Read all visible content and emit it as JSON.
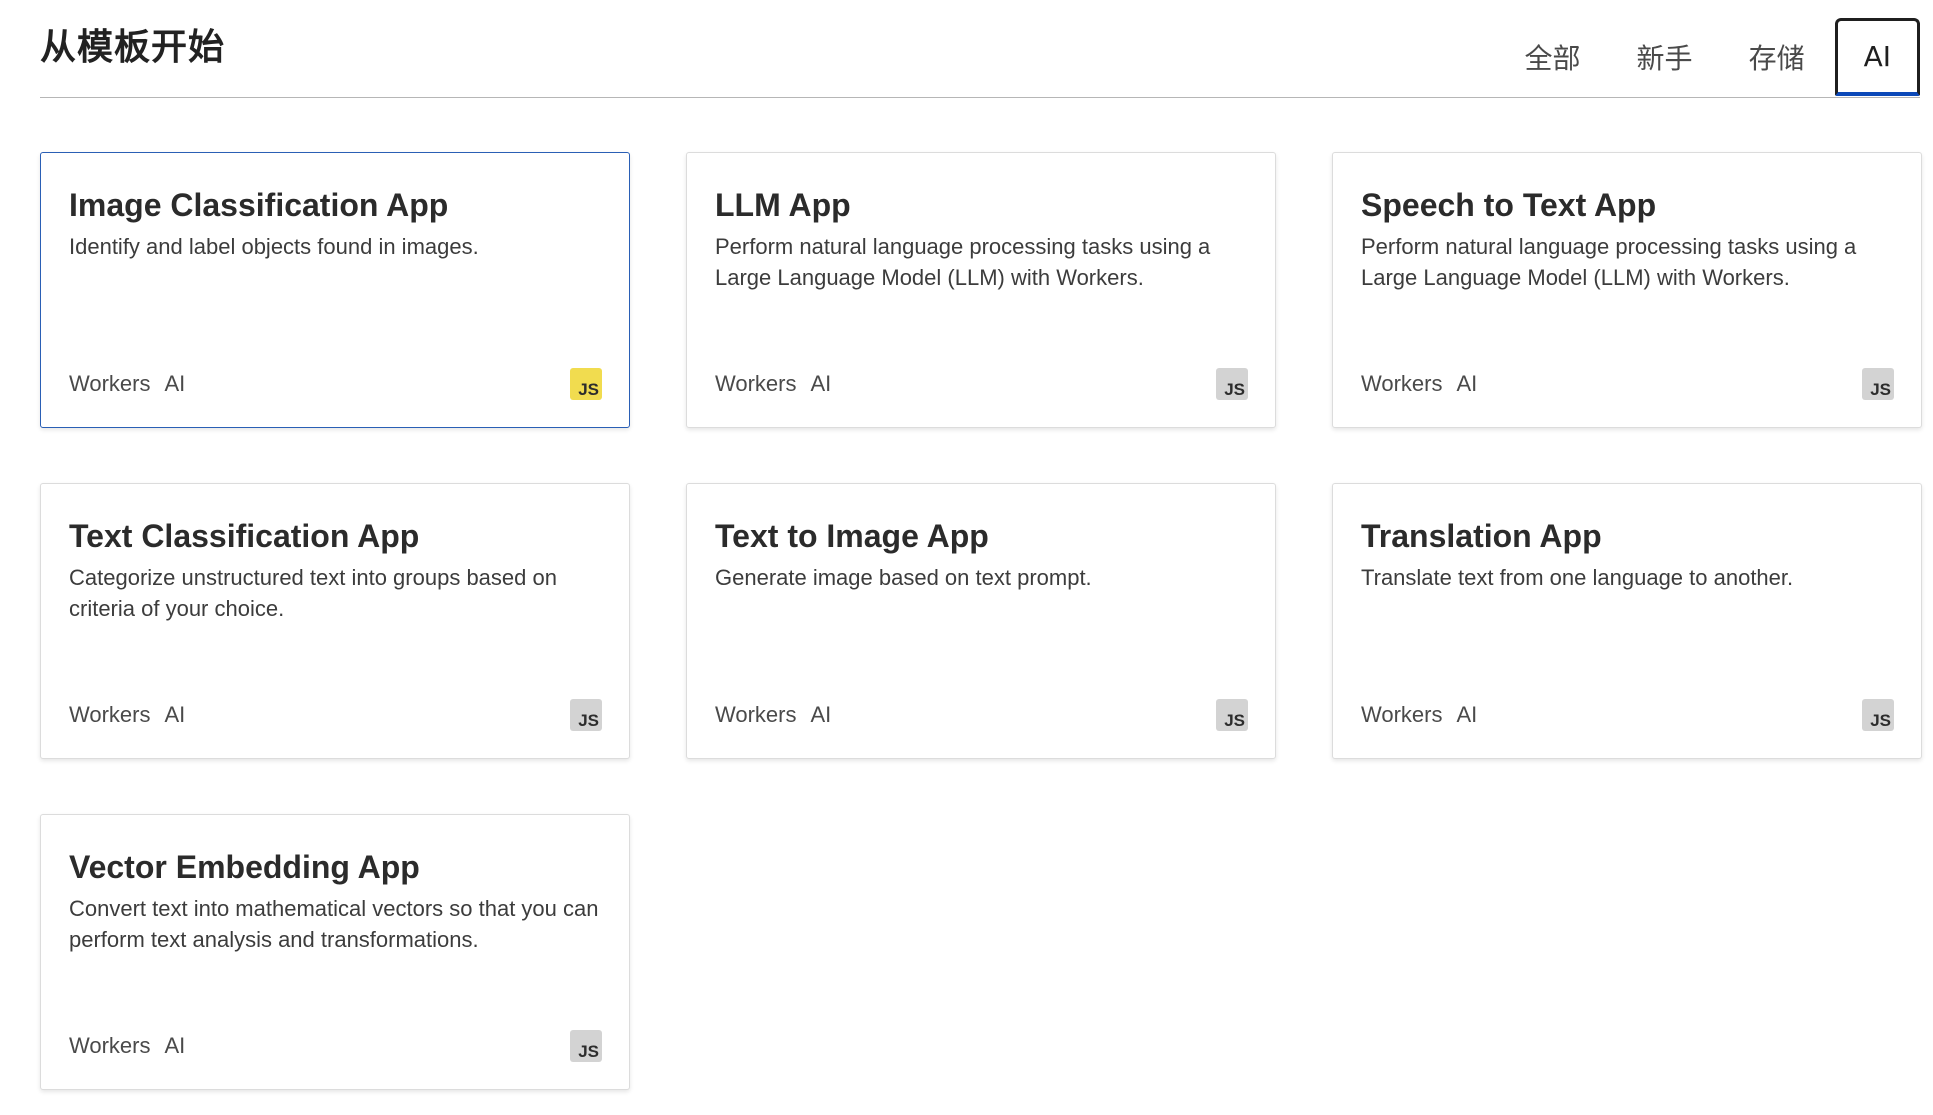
{
  "header": {
    "title": "从模板开始",
    "tabs": [
      {
        "label": "全部",
        "active": false
      },
      {
        "label": "新手",
        "active": false
      },
      {
        "label": "存储",
        "active": false
      },
      {
        "label": "AI",
        "active": true
      }
    ]
  },
  "cards": [
    {
      "title": "Image Classification App",
      "description": "Identify and label objects found in images.",
      "tags": [
        "Workers",
        "AI"
      ],
      "badge": "JS",
      "selected": true
    },
    {
      "title": "LLM App",
      "description": "Perform natural language processing tasks using a Large Language Model (LLM) with Workers.",
      "tags": [
        "Workers",
        "AI"
      ],
      "badge": "JS",
      "selected": false
    },
    {
      "title": "Speech to Text App",
      "description": "Perform natural language processing tasks using a Large Language Model (LLM) with Workers.",
      "tags": [
        "Workers",
        "AI"
      ],
      "badge": "JS",
      "selected": false
    },
    {
      "title": "Text Classification App",
      "description": "Categorize unstructured text into groups based on criteria of your choice.",
      "tags": [
        "Workers",
        "AI"
      ],
      "badge": "JS",
      "selected": false
    },
    {
      "title": "Text to Image App",
      "description": "Generate image based on text prompt.",
      "tags": [
        "Workers",
        "AI"
      ],
      "badge": "JS",
      "selected": false
    },
    {
      "title": "Translation App",
      "description": "Translate text from one language to another.",
      "tags": [
        "Workers",
        "AI"
      ],
      "badge": "JS",
      "selected": false
    },
    {
      "title": "Vector Embedding App",
      "description": "Convert text into mathematical vectors so that you can perform text analysis and transformations.",
      "tags": [
        "Workers",
        "AI"
      ],
      "badge": "JS",
      "selected": false
    }
  ],
  "colors": {
    "selected_border": "#2a5fb5",
    "active_tab_underline": "#0b48b8",
    "js_badge_active": "#f1dc4f",
    "js_badge_inactive": "#d3d3d3"
  }
}
